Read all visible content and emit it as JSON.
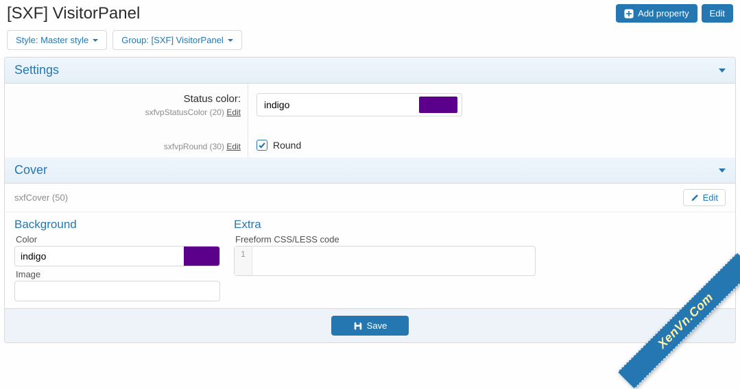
{
  "header": {
    "title": "[SXF] VisitorPanel",
    "add_property_label": "Add property",
    "edit_label": "Edit"
  },
  "filters": {
    "style_label": "Style: Master style",
    "group_label": "Group: [SXF] VisitorPanel"
  },
  "settings": {
    "title": "Settings",
    "status_color": {
      "label": "Status color:",
      "sub_key": "sxfvpStatusColor (20)",
      "edit": "Edit",
      "value": "indigo",
      "swatch": "#5a008a"
    },
    "round": {
      "sub_key": "sxfvpRound (30)",
      "edit": "Edit",
      "label": "Round",
      "checked": true
    }
  },
  "cover": {
    "title": "Cover",
    "sub_key": "sxfCover (50)",
    "edit_label": "Edit",
    "background": {
      "title": "Background",
      "color_label": "Color",
      "color_value": "indigo",
      "color_swatch": "#5a008a",
      "image_label": "Image",
      "image_value": ""
    },
    "extra": {
      "title": "Extra",
      "code_label": "Freeform CSS/LESS code",
      "gutter": "1",
      "code_value": ""
    }
  },
  "footer": {
    "save_label": "Save"
  },
  "watermark": "XenVn.Com"
}
